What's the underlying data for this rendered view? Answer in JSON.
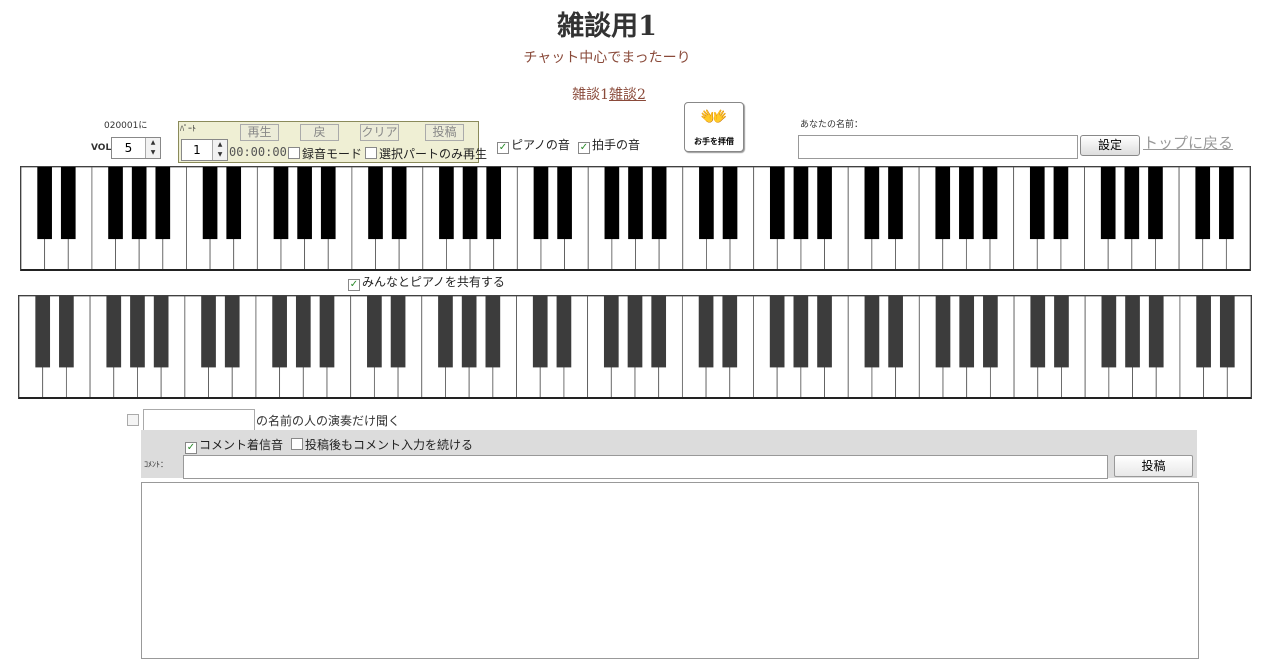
{
  "header": {
    "title": "雑談用1",
    "subtitle": "チャット中心でまったーり",
    "rooms": [
      {
        "label": "雑談1",
        "current": true
      },
      {
        "label": "雑談2",
        "current": false
      }
    ]
  },
  "controls": {
    "user_code": "020001に",
    "vol_label": "VOL",
    "vol_value": "5",
    "part_label": "ﾊﾟｰﾄ",
    "part_value": "1",
    "buttons": {
      "play": "再生",
      "back": "戻",
      "clear": "クリア",
      "post": "投稿"
    },
    "timer": "00:00:00",
    "record_mode": {
      "label": "録音モード",
      "checked": false
    },
    "selected_part_only": {
      "label": "選択パートのみ再生",
      "checked": false
    },
    "piano_sound": {
      "label": "ピアノの音",
      "checked": true
    },
    "clap_sound": {
      "label": "拍手の音",
      "checked": true
    },
    "clap_button_label": "お手を拝借"
  },
  "name": {
    "label": "あなたの名前：",
    "value": "",
    "set_button": "設定",
    "top_link": "トップに戻る"
  },
  "share": {
    "label": "みんなとピアノを共有する",
    "checked": true
  },
  "listen": {
    "value": "",
    "label": "の名前の人の演奏だけ聞く",
    "checked": false
  },
  "comment": {
    "sound": {
      "label": "コメント着信音",
      "checked": true
    },
    "keep": {
      "label": "投稿後もコメント入力を続ける",
      "checked": false
    },
    "field_label": "ｺﾒﾝﾄ：",
    "value": "",
    "post_button": "投稿"
  },
  "pianos": [
    {
      "name": "piano-top",
      "white_keys": 52,
      "black_color": "#000000"
    },
    {
      "name": "piano-bottom",
      "white_keys": 52,
      "black_color": "#3c3c3c"
    }
  ]
}
